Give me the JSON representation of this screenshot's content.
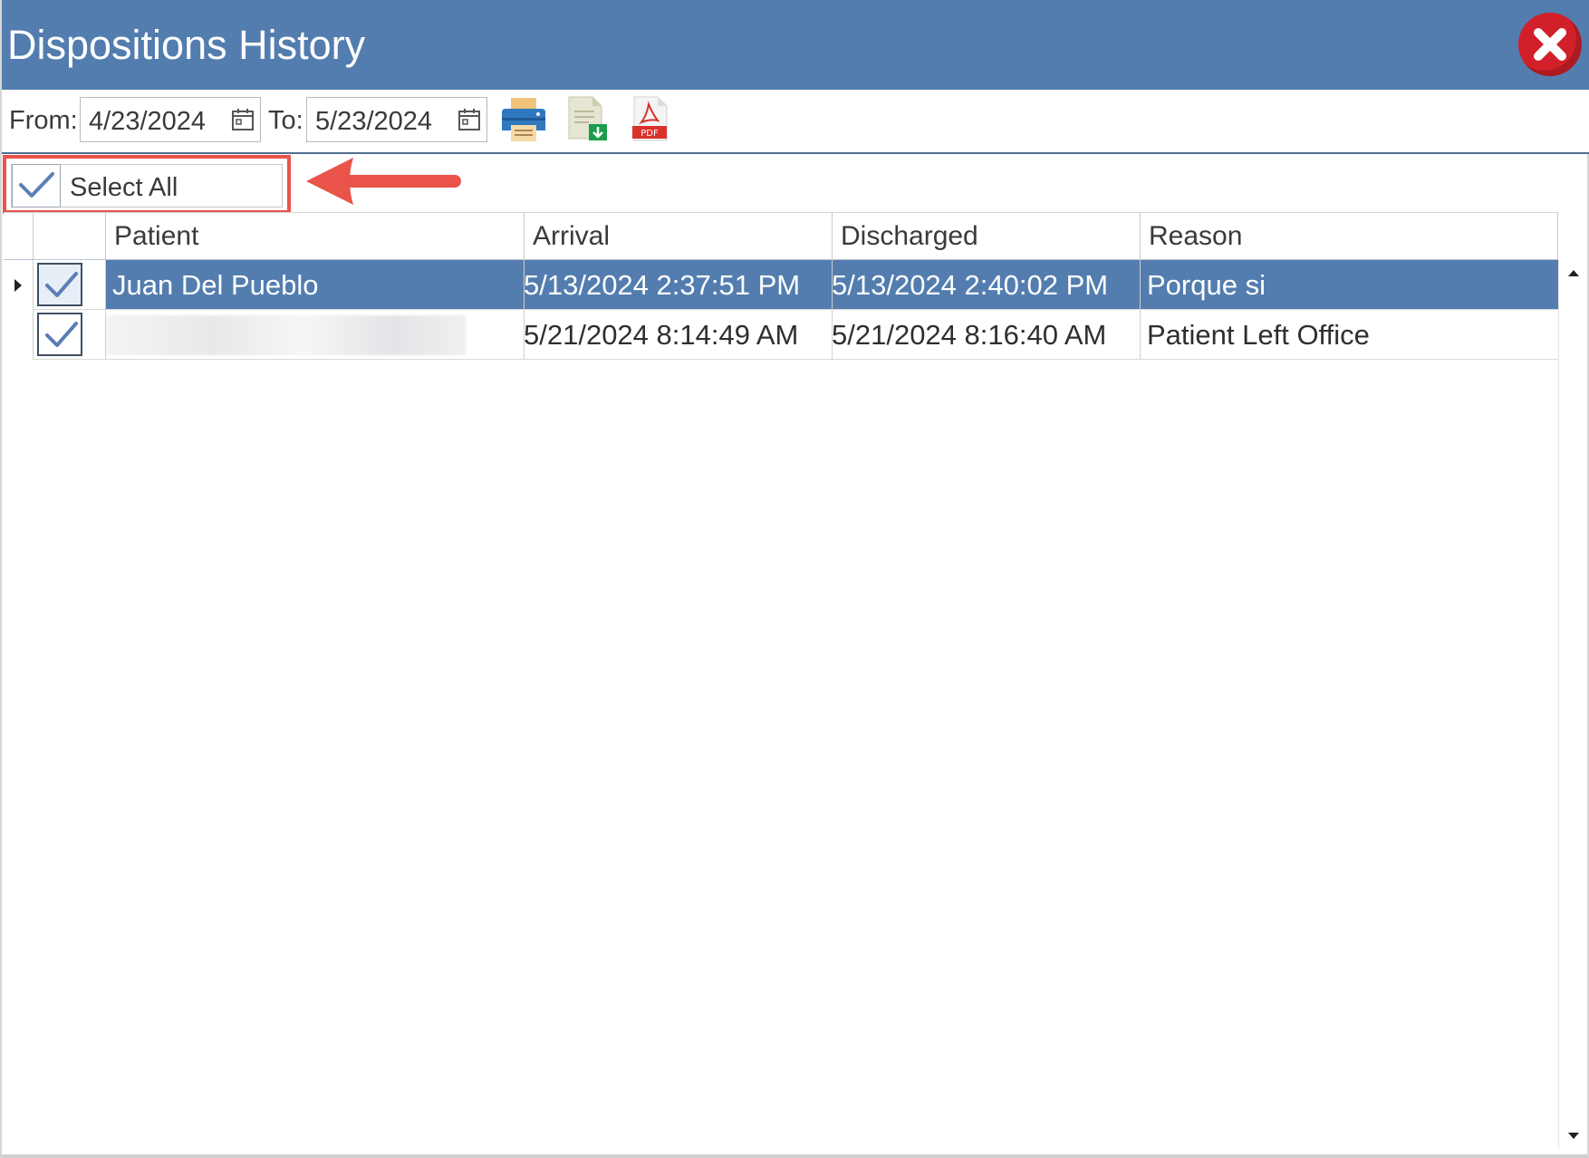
{
  "window": {
    "title": "Dispositions History",
    "title_bar_color": "#537daf",
    "close_icon": "close-icon"
  },
  "toolbar": {
    "from_label": "From:",
    "from_value": "4/23/2024",
    "to_label": "To:",
    "to_value": "5/23/2024",
    "calendar_icon": "calendar-icon",
    "print_icon": "printer-icon",
    "export_icon": "export-document-icon",
    "pdf_icon": "pdf-icon",
    "pdf_icon_text": "PDF"
  },
  "select_all": {
    "label": "Select All",
    "checked": true,
    "highlight_color": "#e9534a",
    "callout_icon": "left-arrow-icon"
  },
  "grid": {
    "columns": [
      "Patient",
      "Arrival",
      "Discharged",
      "Reason"
    ],
    "rows": [
      {
        "checked": true,
        "selected": true,
        "patient": "Juan Del Pueblo",
        "arrival": "5/13/2024 2:37:51 PM",
        "discharged": "5/13/2024 2:40:02 PM",
        "reason": "Porque si"
      },
      {
        "checked": true,
        "selected": false,
        "patient": "",
        "patient_redacted": true,
        "arrival": "5/21/2024 8:14:49 AM",
        "discharged": "5/21/2024 8:16:40 AM",
        "reason": "Patient Left Office"
      }
    ],
    "selected_row_color": "#537daf",
    "row_indicator_icon": "current-row-triangle-icon"
  },
  "scrollbar": {
    "up_icon": "scroll-up-arrow-icon",
    "down_icon": "scroll-down-arrow-icon"
  }
}
